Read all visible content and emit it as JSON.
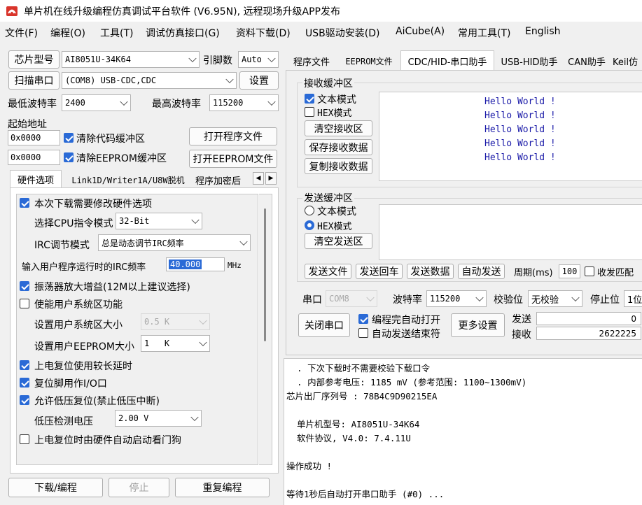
{
  "window": {
    "title": "单片机在线升级编程仿真调试平台软件 (V6.95N), 远程现场升级APP发布"
  },
  "menu": [
    "文件(F)",
    "编程(O)",
    "工具(T)",
    "调试仿真接口(G)",
    "资料下载(D)",
    "USB驱动安装(D)",
    "AiCube(A)",
    "常用工具(T)",
    "English"
  ],
  "left": {
    "chip_label": "芯片型号",
    "chip_value": "AI8051U-34K64",
    "pins_label": "引脚数",
    "pins_value": "Auto",
    "scan_button": "扫描串口",
    "port_value": "(COM8) USB-CDC,CDC",
    "settings_button": "设置",
    "min_baud_label": "最低波特率",
    "min_baud_value": "2400",
    "max_baud_label": "最高波特率",
    "max_baud_value": "115200",
    "start_addr_label": "起始地址",
    "addr1": "0x0000",
    "clear_code": "清除代码缓冲区",
    "open_prog": "打开程序文件",
    "addr2": "0x0000",
    "clear_eeprom": "清除EEPROM缓冲区",
    "open_eeprom": "打开EEPROM文件",
    "tabs": [
      "硬件选项",
      "Link1D/Writer1A/U8W脱机",
      "程序加密后"
    ],
    "hw": {
      "modify_hw": "本次下载需要修改硬件选项",
      "cpu_mode_label": "选择CPU指令模式",
      "cpu_mode_value": "32-Bit",
      "irc_mode_label": "IRC调节模式",
      "irc_mode_value": "总是动态调节IRC频率",
      "irc_freq_label": "输入用户程序运行时的IRC频率",
      "irc_freq_value": "40.000",
      "irc_freq_unit": "MHz",
      "osc_gain": "振荡器放大增益(12M以上建议选择)",
      "user_sys": "使能用户系统区功能",
      "user_sys_size_label": "设置用户系统区大小",
      "user_sys_size_value": "0.5 K",
      "user_eeprom_label": "设置用户EEPROM大小",
      "user_eeprom_value": "1   K",
      "long_delay": "上电复位使用较长延时",
      "reset_io": "复位脚用作I/O口",
      "low_voltage_reset": "允许低压复位(禁止低压中断)",
      "lv_detect_label": "低压检测电压",
      "lv_detect_value": "2.00 V",
      "watchdog": "上电复位时由硬件自动启动看门狗"
    },
    "download_button": "下载/编程",
    "stop_button": "停止",
    "reprogram_button": "重复编程"
  },
  "right": {
    "tabs": [
      "程序文件",
      "EEPROM文件",
      "CDC/HID-串口助手",
      "USB-HID助手",
      "CAN助手",
      "Keil仿"
    ],
    "recv": {
      "title": "接收缓冲区",
      "text_mode": "文本模式",
      "hex_mode": "HEX模式",
      "clear": "清空接收区",
      "save": "保存接收数据",
      "copy": "复制接收数据",
      "lines": [
        "Hello World !",
        "Hello World !",
        "Hello World !",
        "Hello World !",
        "Hello World !"
      ]
    },
    "send": {
      "title": "发送缓冲区",
      "text_mode": "文本模式",
      "hex_mode": "HEX模式",
      "clear": "清空发送区",
      "send_file": "发送文件",
      "send_enter": "发送回车",
      "send_data": "发送数据",
      "auto_send": "自动发送",
      "period_label": "周期(ms)",
      "period_value": "100",
      "match_label": "收发匹配"
    },
    "serial": {
      "port_label": "串口",
      "port_value": "COM8",
      "baud_label": "波特率",
      "baud_value": "115200",
      "parity_label": "校验位",
      "parity_value": "无校验",
      "stop_label": "停止位",
      "stop_value": "1位",
      "close_button": "关闭串口",
      "auto_open": "编程完自动打开",
      "auto_send_end": "自动发送结束符",
      "more_button": "更多设置",
      "send_label": "发送",
      "send_count": "0",
      "recv_label": "接收",
      "recv_count": "2622225"
    },
    "log": [
      "  . 下次下载时不需要校验下载口令",
      "  . 内部参考电压: 1185 mV (参考范围: 1100~1300mV)",
      "芯片出厂序列号 : 78B4C9D90215EA",
      "",
      "  单片机型号: AI8051U-34K64",
      "  软件协议, V4.0: 7.4.11U",
      "",
      "操作成功 !",
      "",
      "等待1秒后自动打开串口助手 (#0) ..."
    ]
  }
}
